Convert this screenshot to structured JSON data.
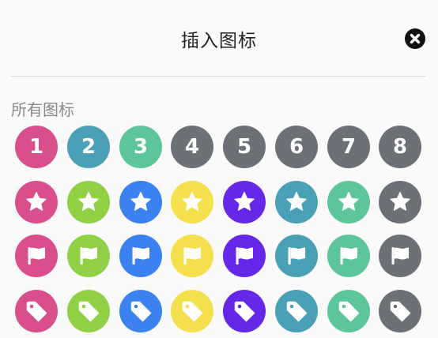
{
  "dialog": {
    "title": "插入图标",
    "close_icon": "close-circle-icon",
    "section_title": "所有图标"
  },
  "colors": {
    "pink": "#d94f8c",
    "teal": "#4aa0b5",
    "green": "#5cc59a",
    "gray": "#6b7176",
    "lime": "#90d044",
    "blue": "#3b82f0",
    "yellow": "#f4e04d",
    "purple": "#6528e8"
  },
  "rows": [
    {
      "kind": "number",
      "icons": [
        {
          "name": "number-1-icon",
          "label": "1",
          "color": "#d94f8c"
        },
        {
          "name": "number-2-icon",
          "label": "2",
          "color": "#4aa0b5"
        },
        {
          "name": "number-3-icon",
          "label": "3",
          "color": "#5cc59a"
        },
        {
          "name": "number-4-icon",
          "label": "4",
          "color": "#6b7176"
        },
        {
          "name": "number-5-icon",
          "label": "5",
          "color": "#6b7176"
        },
        {
          "name": "number-6-icon",
          "label": "6",
          "color": "#6b7176"
        },
        {
          "name": "number-7-icon",
          "label": "7",
          "color": "#6b7176"
        },
        {
          "name": "number-8-icon",
          "label": "8",
          "color": "#6b7176"
        }
      ]
    },
    {
      "kind": "star",
      "icons": [
        {
          "name": "star-icon",
          "color": "#d94f8c"
        },
        {
          "name": "star-icon",
          "color": "#90d044"
        },
        {
          "name": "star-icon",
          "color": "#3b82f0"
        },
        {
          "name": "star-icon",
          "color": "#f4e04d"
        },
        {
          "name": "star-icon",
          "color": "#6528e8"
        },
        {
          "name": "star-icon",
          "color": "#4aa0b5"
        },
        {
          "name": "star-icon",
          "color": "#5cc59a"
        },
        {
          "name": "star-icon",
          "color": "#6b7176"
        }
      ]
    },
    {
      "kind": "flag",
      "icons": [
        {
          "name": "flag-icon",
          "color": "#d94f8c"
        },
        {
          "name": "flag-icon",
          "color": "#90d044"
        },
        {
          "name": "flag-icon",
          "color": "#3b82f0"
        },
        {
          "name": "flag-icon",
          "color": "#f4e04d"
        },
        {
          "name": "flag-icon",
          "color": "#6528e8"
        },
        {
          "name": "flag-icon",
          "color": "#4aa0b5"
        },
        {
          "name": "flag-icon",
          "color": "#5cc59a"
        },
        {
          "name": "flag-icon",
          "color": "#6b7176"
        }
      ]
    },
    {
      "kind": "tag",
      "icons": [
        {
          "name": "tag-icon",
          "color": "#d94f8c"
        },
        {
          "name": "tag-icon",
          "color": "#90d044"
        },
        {
          "name": "tag-icon",
          "color": "#3b82f0"
        },
        {
          "name": "tag-icon",
          "color": "#f4e04d"
        },
        {
          "name": "tag-icon",
          "color": "#6528e8"
        },
        {
          "name": "tag-icon",
          "color": "#4aa0b5"
        },
        {
          "name": "tag-icon",
          "color": "#5cc59a"
        },
        {
          "name": "tag-icon",
          "color": "#6b7176"
        }
      ]
    }
  ]
}
